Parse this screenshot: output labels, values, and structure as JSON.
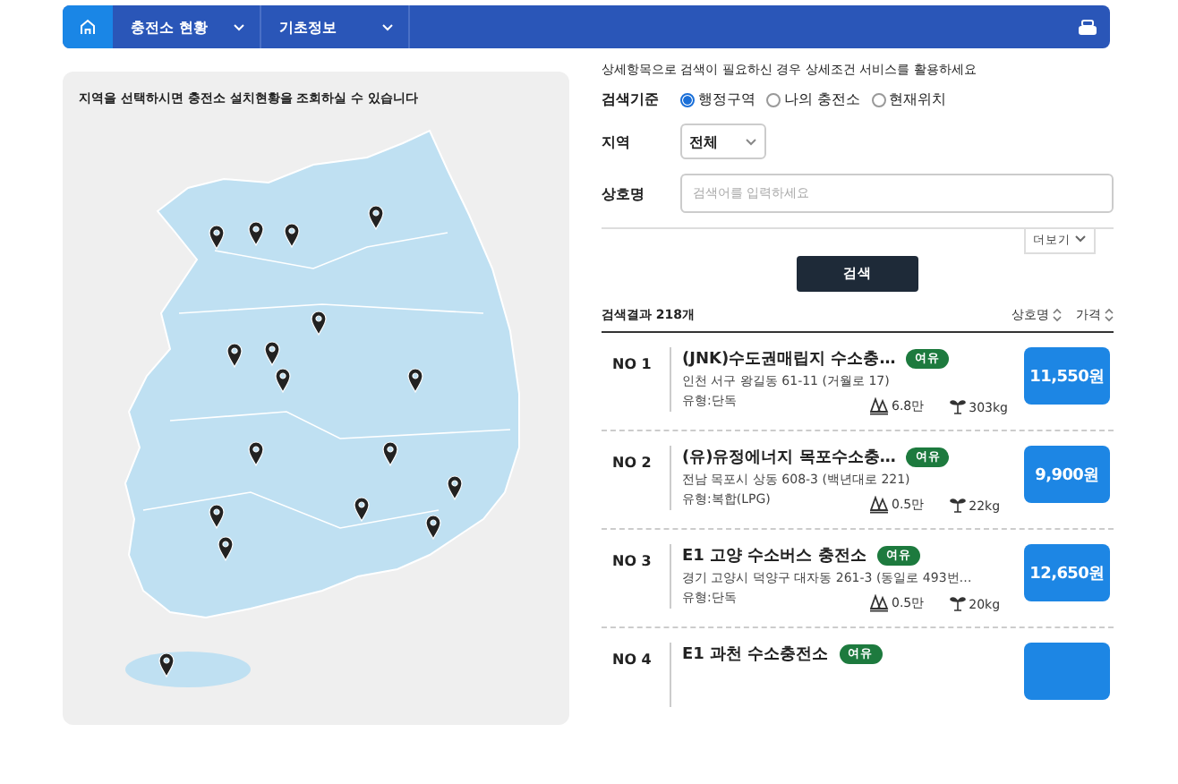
{
  "nav": {
    "items": [
      {
        "label": "충전소 현황"
      },
      {
        "label": "기초정보"
      }
    ]
  },
  "map_panel": {
    "hint": "지역을 선택하시면 충전소 설치현황을 조회하실 수 있습니다"
  },
  "search": {
    "note": "상세항목으로 검색이 필요하신 경우 상세조건 서비스를 활용하세요",
    "criteria_label": "검색기준",
    "criteria": [
      {
        "label": "행정구역",
        "selected": true
      },
      {
        "label": "나의 충전소",
        "selected": false
      },
      {
        "label": "현재위치",
        "selected": false
      }
    ],
    "region_label": "지역",
    "region_value": "전체",
    "name_label": "상호명",
    "name_placeholder": "검색어를 입력하세요",
    "more": "더보기",
    "button": "검색"
  },
  "results": {
    "count": "검색결과 218개",
    "sorts": [
      "상호명",
      "가격"
    ],
    "rows": [
      {
        "no": "NO 1",
        "name": "(JNK)수도권매립지 수소충…",
        "badge": "여유",
        "address": "인천 서구 왕길동 61-11 (거월로 17)",
        "type": "유형:단독",
        "stat_1": "6.8만",
        "stat_2": "303kg",
        "price": "11,550원"
      },
      {
        "no": "NO 2",
        "name": "(유)유정에너지 목포수소충…",
        "badge": "여유",
        "address": "전남 목포시 상동 608-3 (백년대로 221)",
        "type": "유형:복합(LPG)",
        "stat_1": "0.5만",
        "stat_2": "22kg",
        "price": "9,900원"
      },
      {
        "no": "NO 3",
        "name": "E1 고양 수소버스 충전소",
        "badge": "여유",
        "address": "경기 고양시 덕양구 대자동 261-3 (동일로 493번…",
        "type": "유형:단독",
        "stat_1": "0.5만",
        "stat_2": "20kg",
        "price": "12,650원"
      },
      {
        "no": "NO 4",
        "name": "E1 과천 수소충전소",
        "badge": "여유"
      }
    ]
  }
}
